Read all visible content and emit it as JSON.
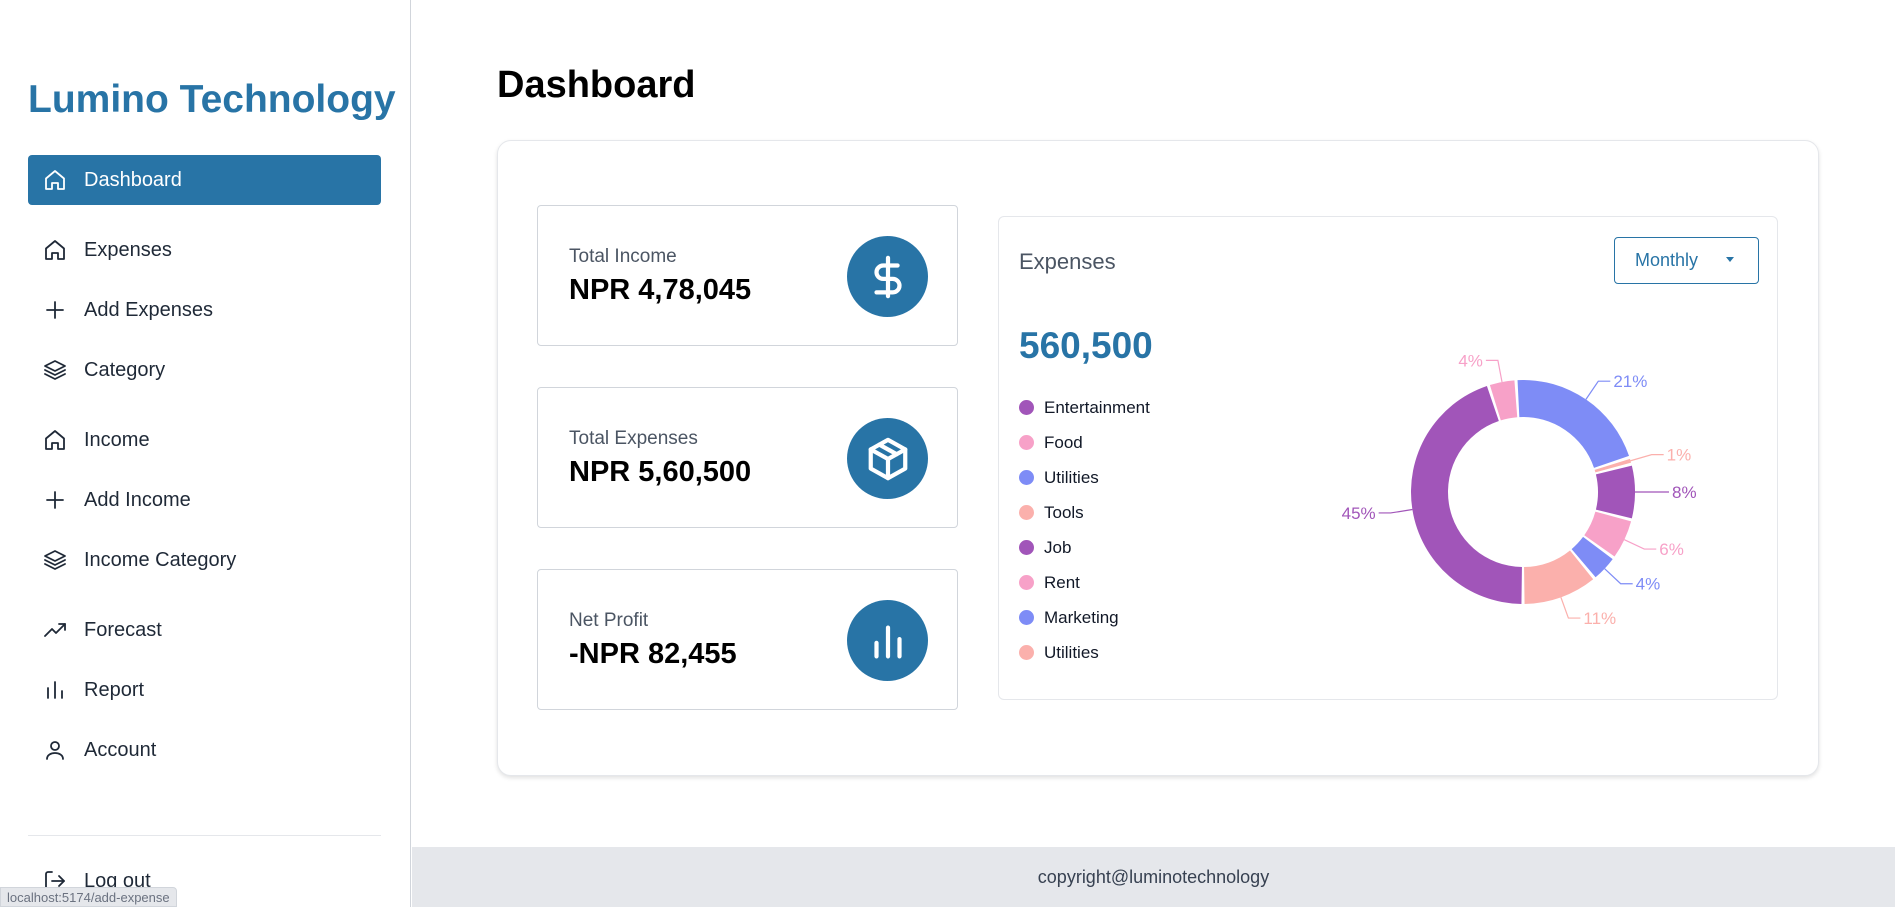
{
  "brand": "Lumino Technology",
  "nav": {
    "items": [
      {
        "label": "Dashboard",
        "icon": "home-icon",
        "active": true
      },
      {
        "label": "Expenses",
        "icon": "home-icon"
      },
      {
        "label": "Add Expenses",
        "icon": "plus-icon"
      },
      {
        "label": "Category",
        "icon": "layers-icon"
      },
      {
        "label": "Income",
        "icon": "home-icon"
      },
      {
        "label": "Add Income",
        "icon": "plus-icon"
      },
      {
        "label": "Income Category",
        "icon": "layers-icon"
      },
      {
        "label": "Forecast",
        "icon": "trending-up-icon"
      },
      {
        "label": "Report",
        "icon": "bar-chart-icon"
      },
      {
        "label": "Account",
        "icon": "user-icon"
      }
    ],
    "logout": "Log out"
  },
  "status_url": "localhost:5174/add-expense",
  "page_title": "Dashboard",
  "stats": [
    {
      "label": "Total Income",
      "value": "NPR 4,78,045",
      "icon": "dollar-icon"
    },
    {
      "label": "Total Expenses",
      "value": "NPR 5,60,500",
      "icon": "box-icon"
    },
    {
      "label": "Net Profit",
      "value": "-NPR 82,455",
      "icon": "bar-chart-icon"
    }
  ],
  "expenses": {
    "title": "Expenses",
    "period": "Monthly",
    "total": "560,500"
  },
  "colors": {
    "brand": "#2874a6",
    "purple": "#a155b9",
    "pink": "#f7a1c8",
    "blue": "#7e8cf6",
    "salmon": "#fbb0ac"
  },
  "chart_data": {
    "type": "pie",
    "categories": [
      "Entertainment",
      "Food",
      "Utilities",
      "Tools",
      "Job",
      "Rent",
      "Marketing",
      "Utilities"
    ],
    "values": [
      45,
      4,
      21,
      1,
      8,
      6,
      4,
      11
    ],
    "value_labels": [
      "45%",
      "4%",
      "21%",
      "1%",
      "8%",
      "6%",
      "4%",
      "11%"
    ],
    "slice_colors": [
      "#a155b9",
      "#f7a1c8",
      "#7e8cf6",
      "#fbb0ac",
      "#a155b9",
      "#f7a1c8",
      "#7e8cf6",
      "#fbb0ac"
    ]
  },
  "footer": "copyright@luminotechnology"
}
